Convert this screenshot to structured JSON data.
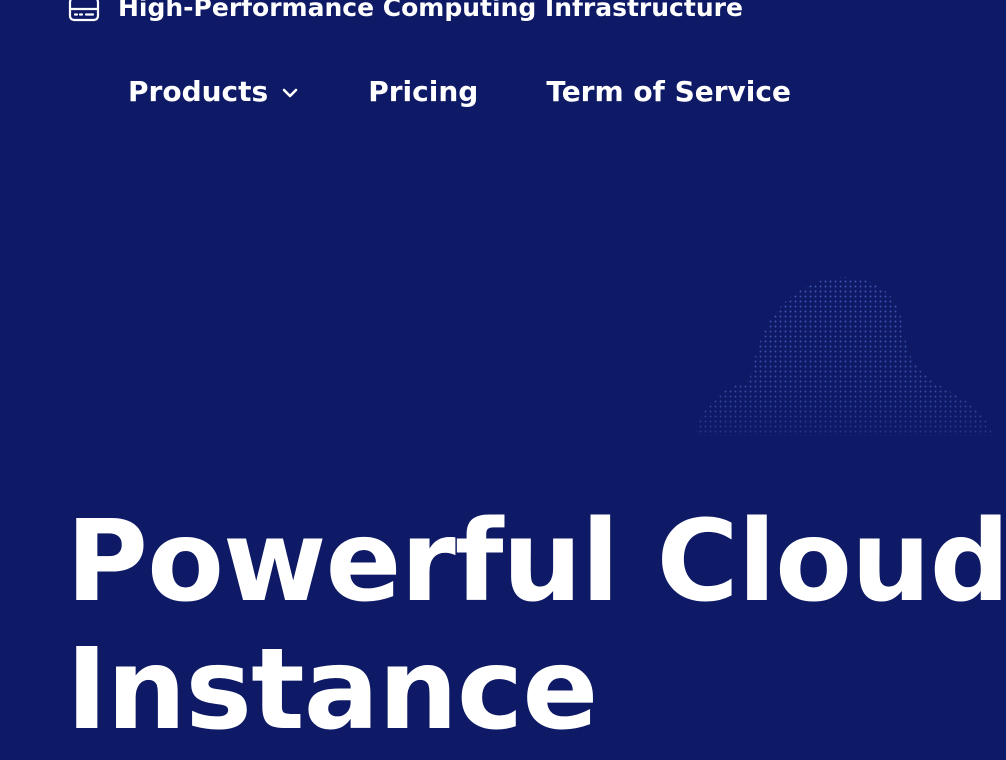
{
  "brand": {
    "title": "High-Performance Computing Infrastructure",
    "icon": "server-icon"
  },
  "nav": {
    "items": [
      {
        "label": "Products",
        "icon": "chevron-down-icon"
      },
      {
        "label": "Pricing"
      },
      {
        "label": "Term of Service"
      }
    ]
  },
  "hero": {
    "title_lines": [
      "Powerful Cloud",
      "Instance"
    ]
  },
  "colors": {
    "background": "#0E1A66",
    "text": "#FFFFFF",
    "pattern_dot": "#4A62C4"
  }
}
